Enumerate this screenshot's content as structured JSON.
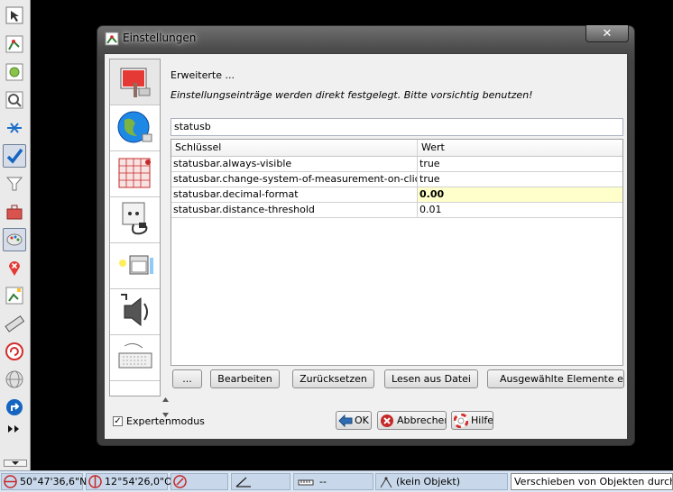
{
  "toolbar": {
    "icons": [
      "select-tool-icon",
      "draw-nodes-icon",
      "improve-way-icon",
      "zoom-icon",
      "merge-icon",
      "checkmark-icon",
      "filter-funnel-icon",
      "toolbox-icon",
      "palette-icon",
      "map-pin-icon",
      "edit-note-icon",
      "ruler-icon",
      "undo-arrow-icon",
      "globe-icon",
      "redo-arrow-icon",
      "more-arrows-icon"
    ]
  },
  "dialog": {
    "title": "Einstellungen",
    "close_glyph": "✕",
    "heading": "Erweiterte ...",
    "warning": "Einstellungseinträge werden direkt festgelegt. Bitte vorsichtig benutzen!",
    "filter_value": "statusb",
    "columns": [
      "Schlüssel",
      "Wert"
    ],
    "rows": [
      {
        "key": "statusbar.always-visible",
        "value": "true"
      },
      {
        "key": "statusbar.change-system-of-measurement-on-click",
        "value": "true"
      },
      {
        "key": "statusbar.decimal-format",
        "value": "0.00"
      },
      {
        "key": "statusbar.distance-threshold",
        "value": "0.01"
      }
    ],
    "buttons": {
      "more": "...",
      "edit": "Bearbeiten",
      "reset": "Zurücksetzen",
      "load": "Lesen aus Datei",
      "export": "Ausgewählte Elemente expo"
    },
    "expert_mode": {
      "label": "Expertenmodus",
      "checked": true,
      "mark": "✓"
    },
    "ok": "OK",
    "cancel": "Abbrechen",
    "help": "Hilfe"
  },
  "statusbar": {
    "lat": "50°47'36,6\"N",
    "lon": "12°54'26,0\"O",
    "measure": "--",
    "object": "(kein Objekt)",
    "help_text": "Verschieben von Objekten durch Zieh"
  },
  "colors": {
    "highlight": "#ffffcc",
    "statusbar": "#dbe6f2",
    "ok_blue": "#2f6db3",
    "cancel_red": "#c62828"
  }
}
